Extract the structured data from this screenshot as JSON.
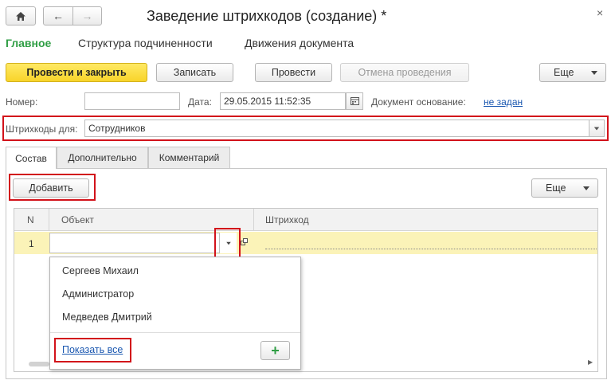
{
  "window": {
    "title": "Заведение штрихкодов (создание) *"
  },
  "nav_tabs": [
    {
      "label": "Главное"
    },
    {
      "label": "Структура подчиненности"
    },
    {
      "label": "Движения документа"
    }
  ],
  "toolbar": {
    "post_close": "Провести и закрыть",
    "write": "Записать",
    "post": "Провести",
    "cancel_post": "Отмена проведения",
    "more": "Еще"
  },
  "header": {
    "number_label": "Номер:",
    "number_value": "",
    "date_label": "Дата:",
    "date_value": "29.05.2015 11:52:35",
    "basis_label": "Документ основание:",
    "basis_link": "не задан"
  },
  "barcodes_for": {
    "label": "Штрихкоды для:",
    "value": "Сотрудников"
  },
  "content_tabs": [
    {
      "label": "Состав"
    },
    {
      "label": "Дополнительно"
    },
    {
      "label": "Комментарий"
    }
  ],
  "table_toolbar": {
    "add": "Добавить",
    "more": "Еще"
  },
  "table": {
    "columns": [
      "N",
      "Объект",
      "Штрихкод"
    ],
    "rows": [
      {
        "n": "1",
        "object": "",
        "barcode": ""
      }
    ]
  },
  "dropdown": {
    "items": [
      "Сергеев Михаил",
      "Администратор",
      "Медведев Дмитрий"
    ],
    "show_all": "Показать все",
    "add_icon": "+"
  },
  "colors": {
    "accent_green": "#2f9e44",
    "primary_yellow": "#f8d42a",
    "highlight_row": "#fbf3b8",
    "link_blue": "#1a57b0",
    "annotation_red": "#d2121a"
  }
}
